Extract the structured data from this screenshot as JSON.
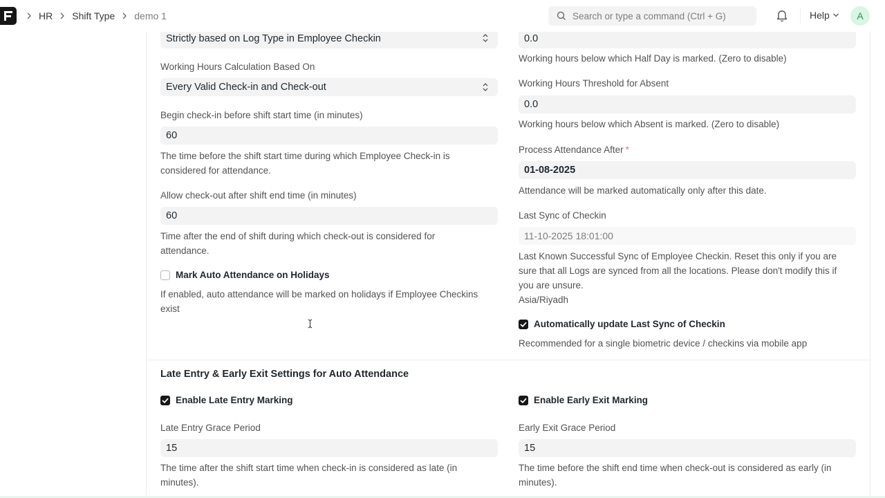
{
  "breadcrumb": {
    "items": [
      "HR",
      "Shift Type",
      "demo 1"
    ]
  },
  "search": {
    "placeholder": "Search or type a command (Ctrl + G)"
  },
  "help": {
    "label": "Help"
  },
  "user": {
    "avatar_letter": "A"
  },
  "left": {
    "determine_checkin_value": "Strictly based on Log Type in Employee Checkin",
    "working_hours_calc": {
      "label": "Working Hours Calculation Based On",
      "value": "Every Valid Check-in and Check-out"
    },
    "begin_checkin": {
      "label": "Begin check-in before shift start time (in minutes)",
      "value": "60",
      "desc_line1": "The time before the shift start time during which Employee Check-in is",
      "desc_line2": "considered for attendance."
    },
    "allow_checkout": {
      "label": "Allow check-out after shift end time (in minutes)",
      "value": "60",
      "desc_line1": "Time after the end of shift during which check-out is considered for",
      "desc_line2": "attendance."
    },
    "mark_auto_holidays": {
      "label": "Mark Auto Attendance on Holidays",
      "checked": false,
      "desc_line1": "If enabled, auto attendance will be marked on holidays if Employee Checkins",
      "desc_line2": "exist"
    }
  },
  "right": {
    "half_day_threshold": {
      "value": "0.0",
      "desc": "Working hours below which Half Day is marked. (Zero to disable)"
    },
    "absent_threshold": {
      "label": "Working Hours Threshold for Absent",
      "value": "0.0",
      "desc": "Working hours below which Absent is marked. (Zero to disable)"
    },
    "process_after": {
      "label": "Process Attendance After",
      "required_mark": "*",
      "value": "01-08-2025",
      "desc": "Attendance will be marked automatically only after this date."
    },
    "last_sync": {
      "label": "Last Sync of Checkin",
      "value": "11-10-2025 18:01:00",
      "desc_line1": "Last Known Successful Sync of Employee Checkin. Reset this only if you are",
      "desc_line2": "sure that all Logs are synced from all the locations. Please don't modify this if",
      "desc_line3": "you are unsure.",
      "timezone": "Asia/Riyadh"
    },
    "auto_update_sync": {
      "label": "Automatically update Last Sync of Checkin",
      "checked": true,
      "desc": "Recommended for a single biometric device / checkins via mobile app"
    }
  },
  "late_early": {
    "title": "Late Entry & Early Exit Settings for Auto Attendance",
    "enable_late": {
      "label": "Enable Late Entry Marking",
      "checked": true
    },
    "enable_early": {
      "label": "Enable Early Exit Marking",
      "checked": true
    },
    "late_grace": {
      "label": "Late Entry Grace Period",
      "value": "15",
      "desc_line1": "The time after the shift start time when check-in is considered as late (in",
      "desc_line2": "minutes)."
    },
    "early_grace": {
      "label": "Early Exit Grace Period",
      "value": "15",
      "desc_line1": "The time before the shift end time when check-out is considered as early (in",
      "desc_line2": "minutes)."
    }
  },
  "colors": {
    "accent": "#171717",
    "input_bg": "#f3f3f3",
    "avatar_bg": "#d9f5e3",
    "avatar_fg": "#2f8f5b",
    "required": "#e57373"
  }
}
